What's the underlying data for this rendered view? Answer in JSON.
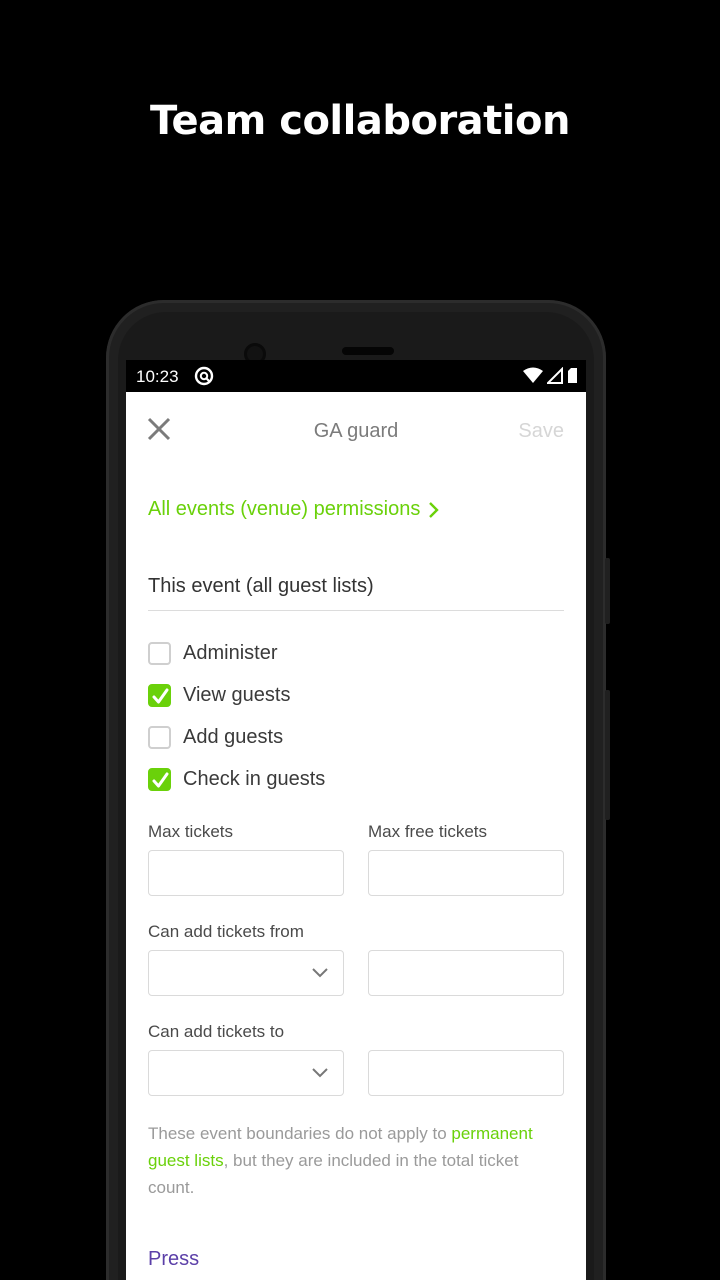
{
  "headline": "Team collaboration",
  "status_bar": {
    "time": "10:23"
  },
  "app_bar": {
    "title": "GA guard",
    "save_label": "Save"
  },
  "venue_link": "All events (venue) permissions",
  "section_title": "This event (all guest lists)",
  "permissions": [
    {
      "label": "Administer",
      "checked": false
    },
    {
      "label": "View guests",
      "checked": true
    },
    {
      "label": "Add guests",
      "checked": false
    },
    {
      "label": "Check in guests",
      "checked": true
    }
  ],
  "fields": {
    "max_tickets_label": "Max tickets",
    "max_tickets_value": "",
    "max_free_tickets_label": "Max free tickets",
    "max_free_tickets_value": "",
    "add_from_label": "Can add tickets from",
    "add_from_select": "",
    "add_from_value": "",
    "add_to_label": "Can add tickets to",
    "add_to_select": "",
    "add_to_value": ""
  },
  "note": {
    "part1": "These event boundaries do not apply to ",
    "link": "permanent guest lists",
    "part2": ", but they are included in the total ticket count."
  },
  "press_title": "Press",
  "colors": {
    "accent": "#6ad10a",
    "press": "#5b3fa8",
    "background": "#000000"
  }
}
